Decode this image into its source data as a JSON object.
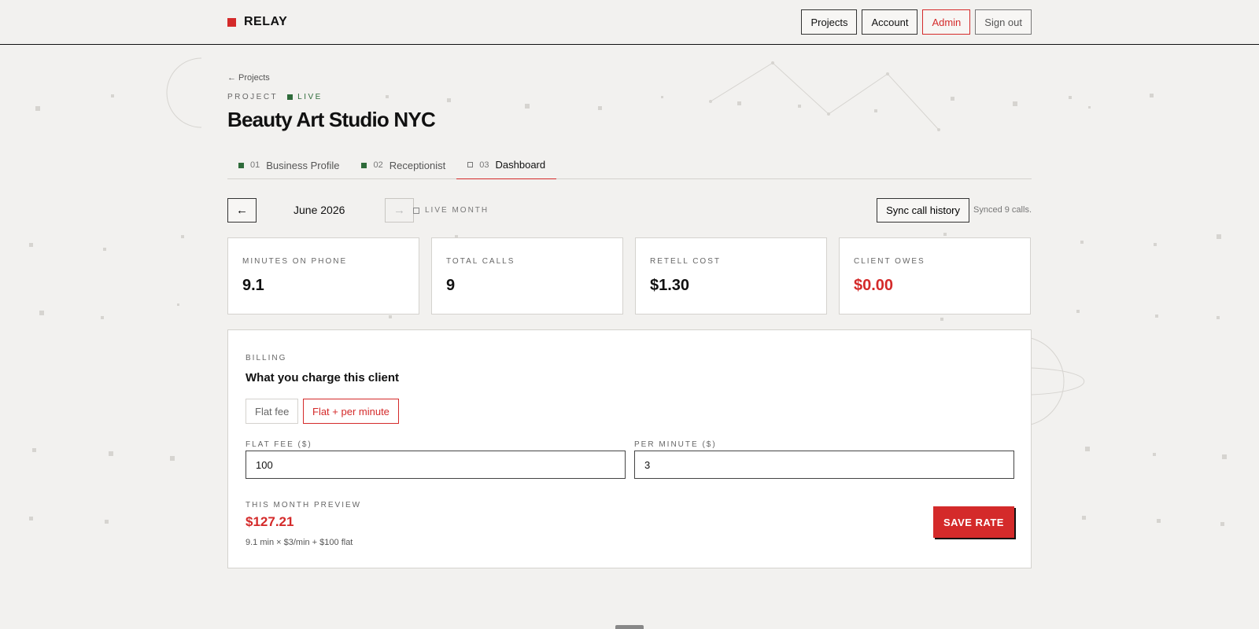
{
  "brand": {
    "name": "RELAY",
    "accent": "#d42a2a"
  },
  "nav": {
    "projects": "Projects",
    "account": "Account",
    "admin": "Admin",
    "sign_out": "Sign out"
  },
  "breadcrumb": {
    "back": "← Projects"
  },
  "project": {
    "eyebrow": "PROJECT",
    "status": "LIVE",
    "status_color": "#2e6b3a",
    "title": "Beauty Art Studio NYC"
  },
  "tabs": [
    {
      "num": "01",
      "label": "Business Profile",
      "done": true
    },
    {
      "num": "02",
      "label": "Receptionist",
      "done": true
    },
    {
      "num": "03",
      "label": "Dashboard",
      "done": false,
      "active": true
    }
  ],
  "period": {
    "prev_icon": "←",
    "next_icon": "→",
    "month": "June 2026",
    "live_label": "LIVE MONTH",
    "sync_label": "Sync call history",
    "synced_text": "Synced 9 calls."
  },
  "stats": [
    {
      "label": "MINUTES ON PHONE",
      "value": "9.1"
    },
    {
      "label": "TOTAL CALLS",
      "value": "9"
    },
    {
      "label": "RETELL COST",
      "value": "$1.30"
    },
    {
      "label": "CLIENT OWES",
      "value": "$0.00"
    }
  ],
  "billing": {
    "section": "BILLING",
    "title": "What you charge this client",
    "modes": {
      "flat": "Flat fee",
      "per_minute": "Flat + per minute",
      "selected": "per_minute"
    },
    "flat_fee_label": "FLAT FEE ($)",
    "flat_fee_value": "100",
    "per_minute_label": "PER MINUTE ($)",
    "per_minute_value": "3",
    "preview_label": "THIS MONTH PREVIEW",
    "preview_amount": "$127.21",
    "preview_formula": "9.1 min × $3/min + $100 flat",
    "save_label": "SAVE RATE"
  }
}
